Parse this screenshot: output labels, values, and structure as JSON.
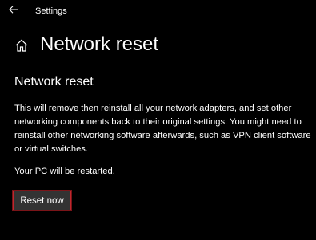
{
  "window": {
    "title": "Settings"
  },
  "header": {
    "back_icon": "back-arrow-icon",
    "home_icon": "home-icon",
    "title": "Network reset"
  },
  "section": {
    "heading": "Network reset",
    "description": "This will remove then reinstall all your network adapters, and set other networking components back to their original settings. You might need to reinstall other networking software afterwards, such as VPN client software or virtual switches.",
    "restart_note": "Your PC will be restarted."
  },
  "actions": {
    "reset_label": "Reset now"
  },
  "colors": {
    "background": "#000000",
    "text": "#ffffff",
    "button_background": "#333333",
    "button_focus_border": "#c0272d"
  }
}
